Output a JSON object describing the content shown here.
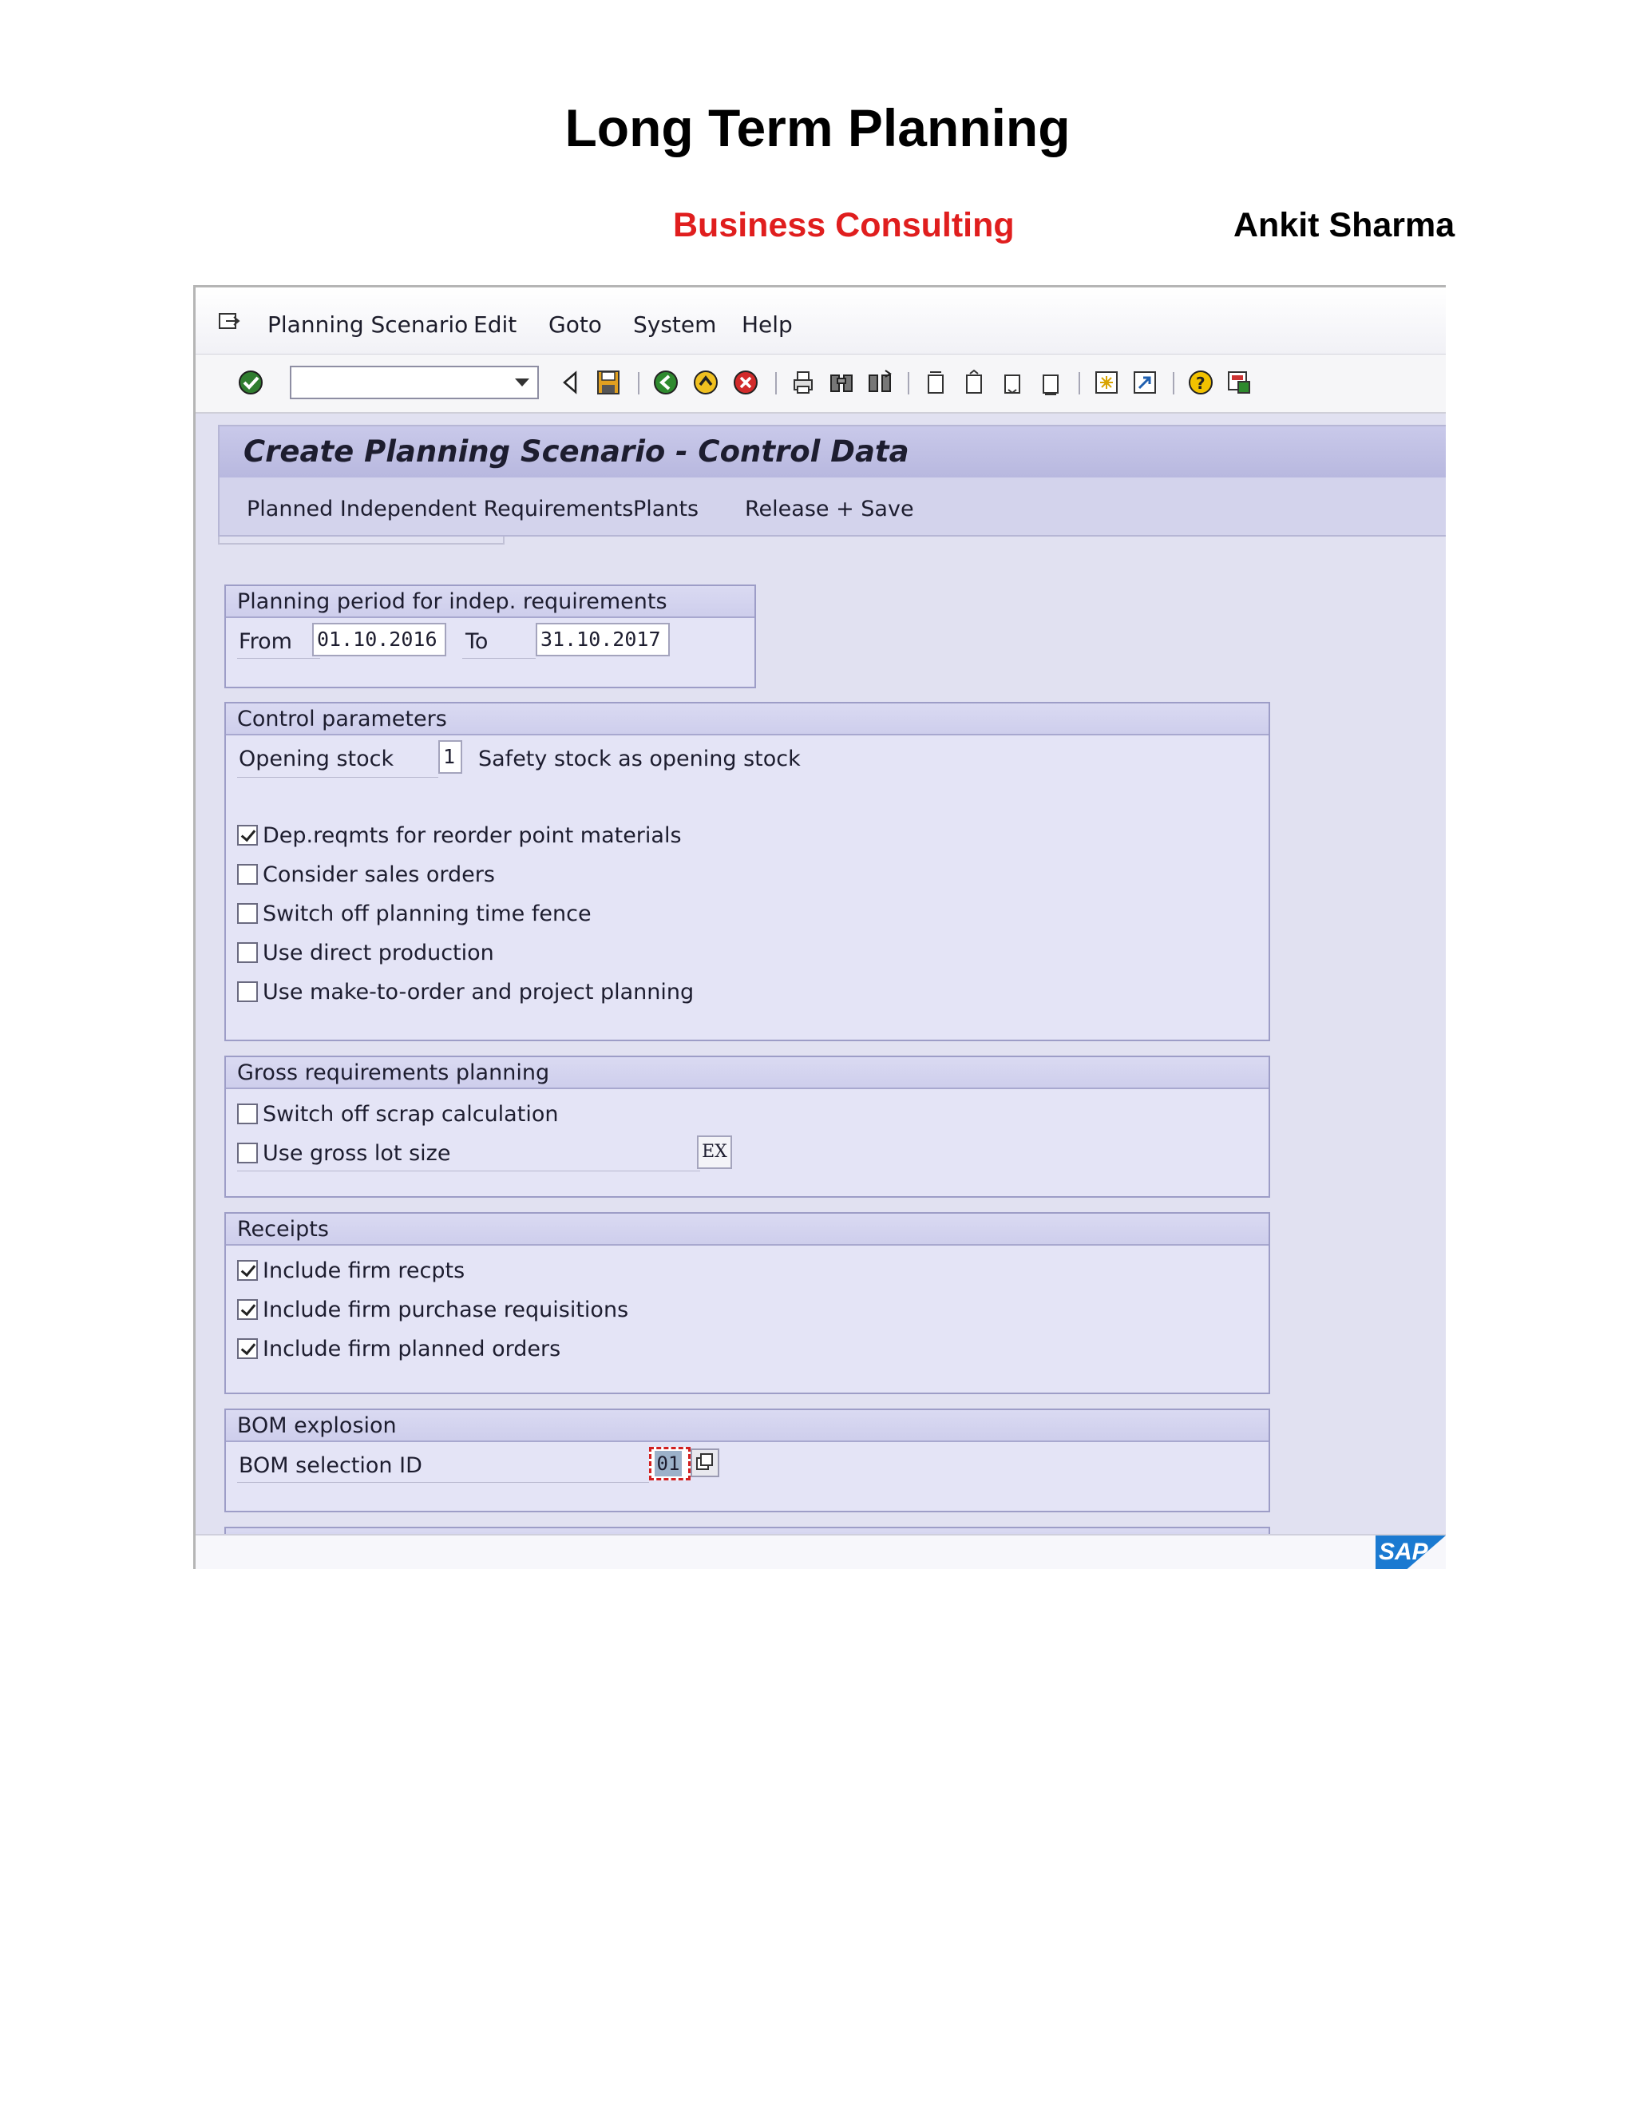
{
  "document": {
    "title": "Long Term Planning",
    "subtitle_left": "Business Consulting",
    "subtitle_right": "Ankit Sharma"
  },
  "menu": {
    "items": [
      "Planning Scenario",
      "Edit",
      "Goto",
      "System",
      "Help"
    ]
  },
  "screen": {
    "title": "Create Planning Scenario - Control Data",
    "app_toolbar": [
      "Planned Independent Requirements",
      "Plants",
      "Release + Save"
    ]
  },
  "planning_period": {
    "title": "Planning period for indep. requirements",
    "from_label": "From",
    "from_value": "01.10.2016",
    "to_label": "To",
    "to_value": "31.10.2017"
  },
  "control_parameters": {
    "title": "Control parameters",
    "opening_stock_label": "Opening stock",
    "opening_stock_value": "1",
    "opening_stock_desc": "Safety stock as opening stock",
    "checkboxes": [
      {
        "label": "Dep.reqmts for reorder point materials",
        "checked": true
      },
      {
        "label": "Consider sales orders",
        "checked": false
      },
      {
        "label": "Switch off planning time fence",
        "checked": false
      },
      {
        "label": "Use direct production",
        "checked": false
      },
      {
        "label": "Use make-to-order and project planning",
        "checked": false
      }
    ]
  },
  "gross_requirements": {
    "title": "Gross requirements planning",
    "scrap_label": "Switch off scrap calculation",
    "scrap_checked": false,
    "lot_label": "Use gross lot size",
    "lot_checked": false,
    "lot_value": "EX"
  },
  "receipts": {
    "title": "Receipts",
    "checkboxes": [
      {
        "label": "Include firm recpts",
        "checked": true
      },
      {
        "label": "Include firm purchase requisitions",
        "checked": true
      },
      {
        "label": "Include firm planned orders",
        "checked": true
      }
    ]
  },
  "bom_explosion": {
    "title": "BOM explosion",
    "selection_label": "BOM selection ID",
    "selection_value": "01"
  },
  "branding": {
    "logo_text": "SAP"
  }
}
